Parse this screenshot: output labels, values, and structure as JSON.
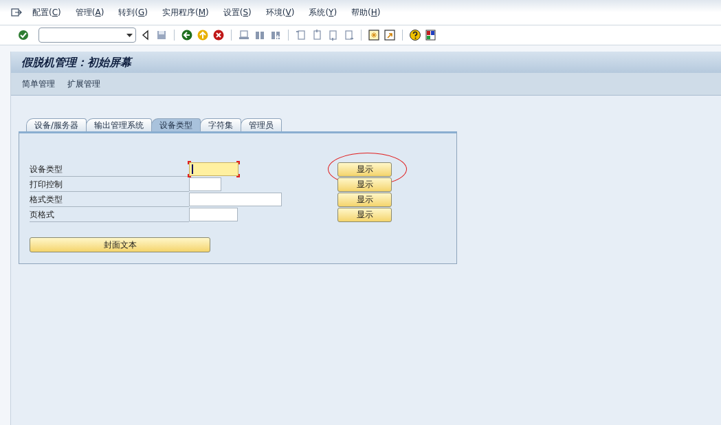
{
  "menu": [
    "配置(C)",
    "管理(A)",
    "转到(G)",
    "实用程序(M)",
    "设置(S)",
    "环境(V)",
    "系统(Y)",
    "帮助(H)"
  ],
  "title": "假脱机管理：初始屏幕",
  "app_toolbar": [
    "简单管理",
    "扩展管理"
  ],
  "tabs": [
    {
      "label": "设备/服务器",
      "selected": false
    },
    {
      "label": "输出管理系统",
      "selected": false
    },
    {
      "label": "设备类型",
      "selected": true
    },
    {
      "label": "字符集",
      "selected": false
    },
    {
      "label": "管理员",
      "selected": false
    }
  ],
  "fields": [
    {
      "label": "设备类型",
      "focused": true,
      "button": "显示",
      "circled": true
    },
    {
      "label": "打印控制",
      "focused": false,
      "button": "显示",
      "circled": false
    },
    {
      "label": "格式类型",
      "focused": false,
      "button": "显示",
      "circled": false
    },
    {
      "label": "页格式",
      "focused": false,
      "button": "显示",
      "circled": false
    }
  ],
  "cover_text_button": "封面文本"
}
